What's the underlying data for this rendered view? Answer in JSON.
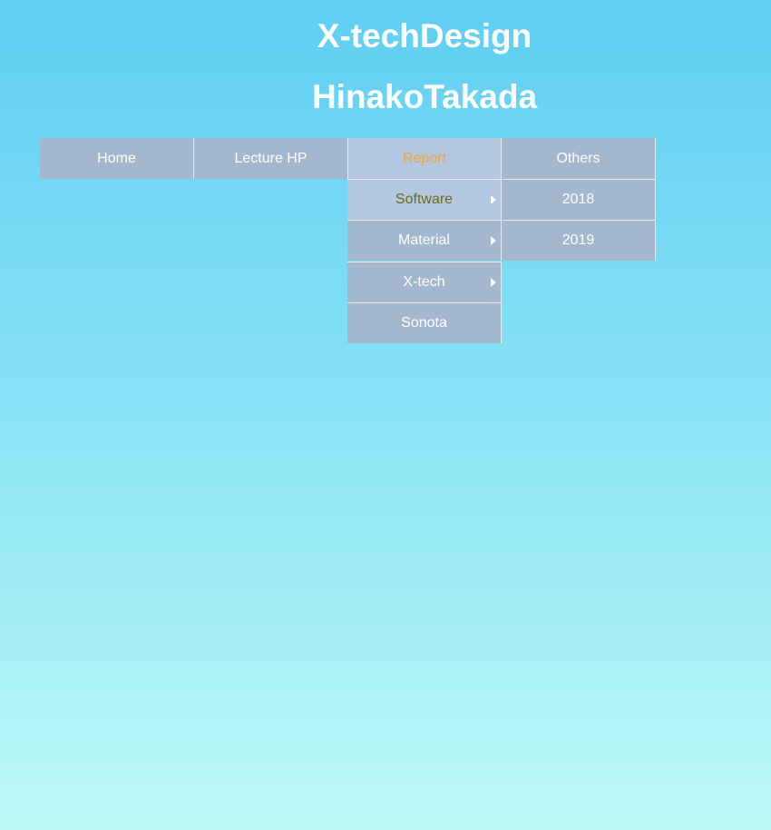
{
  "header": {
    "title_line1": "X-techDesign",
    "title_line2": "HinakoTakada"
  },
  "nav": {
    "items": [
      {
        "label": "Home"
      },
      {
        "label": "Lecture HP"
      },
      {
        "label": "Report"
      },
      {
        "label": "Others"
      }
    ],
    "report_submenu": [
      {
        "label": "Software"
      },
      {
        "label": "Material"
      },
      {
        "label": "X-tech"
      },
      {
        "label": "Sonota"
      }
    ],
    "software_submenu": [
      {
        "label": "2018"
      },
      {
        "label": "2019"
      }
    ]
  },
  "colors": {
    "nav_bg": "#a3b7cf",
    "nav_active_bg": "#b3c7e1",
    "active_text": "#f2a63a",
    "hover_text": "#6d6a1f"
  },
  "icons": {
    "submenu_arrow": "caret-right-icon"
  }
}
